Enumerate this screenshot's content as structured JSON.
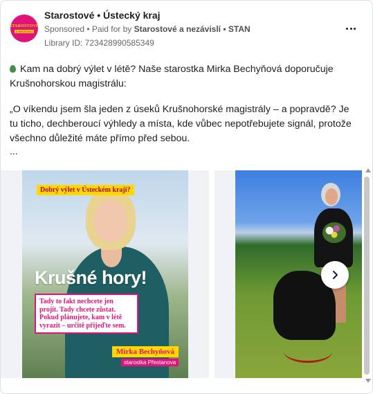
{
  "ad": {
    "page_name": "Starostové • Ústecký kraj",
    "sponsored": "Sponsored",
    "paid_for_prefix": " • Paid for by ",
    "paid_for_name": "Starostové a nezávislí • STAN",
    "library_id": "Library ID: 723428990585349",
    "avatar_brand_line1": "STAROSTOVÉ",
    "avatar_brand_line2": "A NEZÁVISLÍ",
    "more_icon": "more-horizontal-icon"
  },
  "post": {
    "intro": "Kam na dobrý výlet v létě? Naše starostka Mirka Bechyňová doporučuje Krušnohorskou magistrálu:",
    "quote": "„O víkendu jsem šla jeden z úseků Krušnohorské magistrály – a popravdě? Je tu ticho, dechberoucí výhledy a místa, kde vůbec nepotřebujete signál, protože všechno důležité máte přímo před sebou.",
    "ellipsis": "...",
    "leaf_icon": "green-drop-icon"
  },
  "carousel": {
    "card1": {
      "tag": "Dobrý výlet v Ústeckém kraji?",
      "headline": "Krušné hory!",
      "body": "Tady to fakt nechcete jen projít. Tady chcete zůstat. Pokud plánujete, kam v létě vyrazit – určitě přijeďte sem.",
      "name": "Mirka Bechyňová",
      "role": "starostka Přestanova"
    },
    "next_icon": "chevron-right-icon"
  },
  "colors": {
    "brand_pink": "#e0137a",
    "brand_yellow": "#ffd800",
    "text_primary": "#1c1e21",
    "text_secondary": "#65676b"
  }
}
